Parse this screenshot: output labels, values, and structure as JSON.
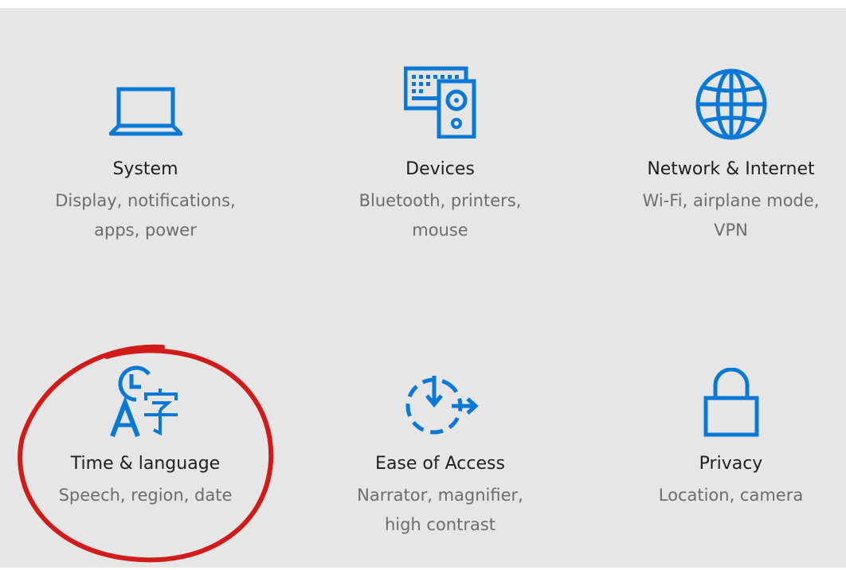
{
  "colors": {
    "accent": "#0a78d7",
    "background": "#e6e6e6",
    "title_text": "#1f1f1f",
    "desc_text": "#6d6d6d",
    "annotation": "#d11a1a"
  },
  "settings": {
    "tiles": [
      {
        "id": "system",
        "icon": "laptop-icon",
        "title": "System",
        "description": "Display, notifications,\napps, power"
      },
      {
        "id": "devices",
        "icon": "devices-icon",
        "title": "Devices",
        "description": "Bluetooth, printers,\nmouse"
      },
      {
        "id": "network",
        "icon": "globe-icon",
        "title": "Network & Internet",
        "description": "Wi-Fi, airplane mode,\nVPN"
      },
      {
        "id": "time-language",
        "icon": "time-language-icon",
        "title": "Time & language",
        "description": "Speech, region, date"
      },
      {
        "id": "ease-of-access",
        "icon": "ease-of-access-icon",
        "title": "Ease of Access",
        "description": "Narrator, magnifier,\nhigh contrast"
      },
      {
        "id": "privacy",
        "icon": "lock-icon",
        "title": "Privacy",
        "description": "Location, camera"
      }
    ]
  },
  "annotation": {
    "highlighted_tile": "time-language",
    "shape": "hand-drawn red ellipse"
  }
}
